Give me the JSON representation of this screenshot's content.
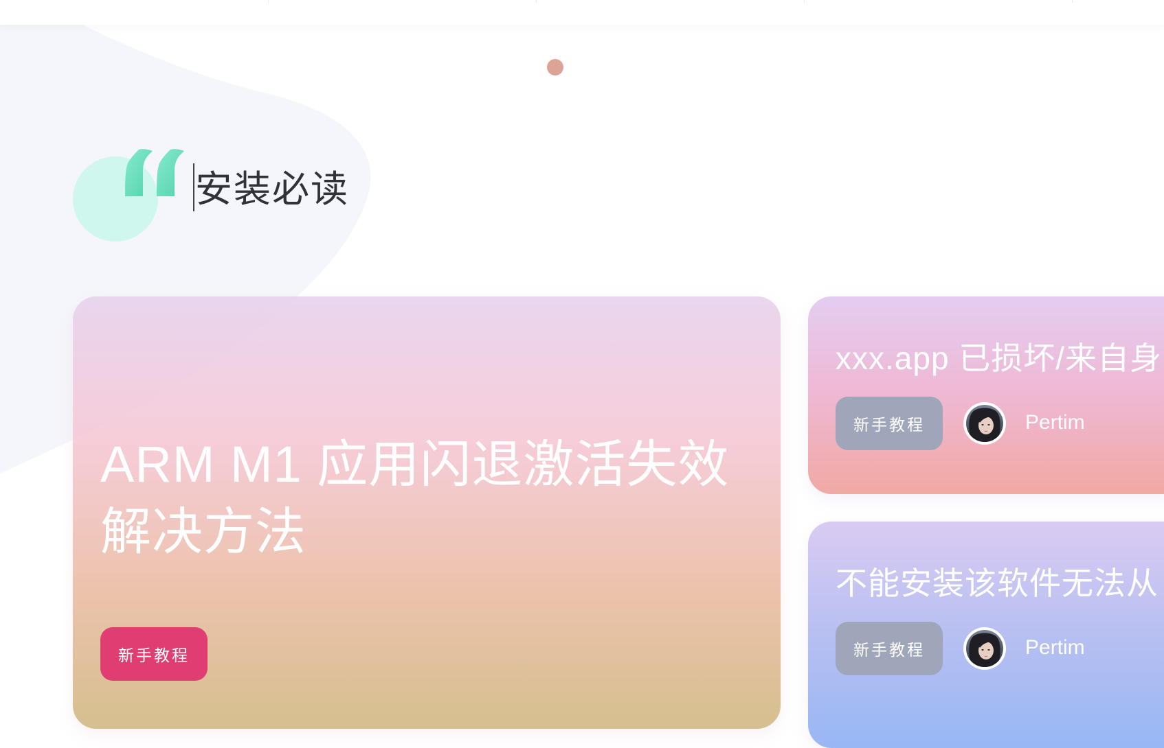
{
  "section": {
    "title": "安装必读"
  },
  "cards": {
    "featured": {
      "title": "ARM M1 应用闪退激活失效解决方法",
      "tag": "新手教程"
    },
    "side_1": {
      "title": "xxx.app 已损坏/来自身",
      "tag": "新手教程",
      "author": "Pertim"
    },
    "side_2": {
      "title": "不能安装该软件无法从",
      "tag": "新手教程",
      "author": "Pertim"
    }
  },
  "colors": {
    "accent_tag": "#e03d72",
    "muted_tag": "#9fa6ba",
    "quote": "#6ad9b8",
    "carousel_dot": "#dda395"
  },
  "icons": {
    "quote": "quote-icon",
    "avatar": "avatar"
  }
}
